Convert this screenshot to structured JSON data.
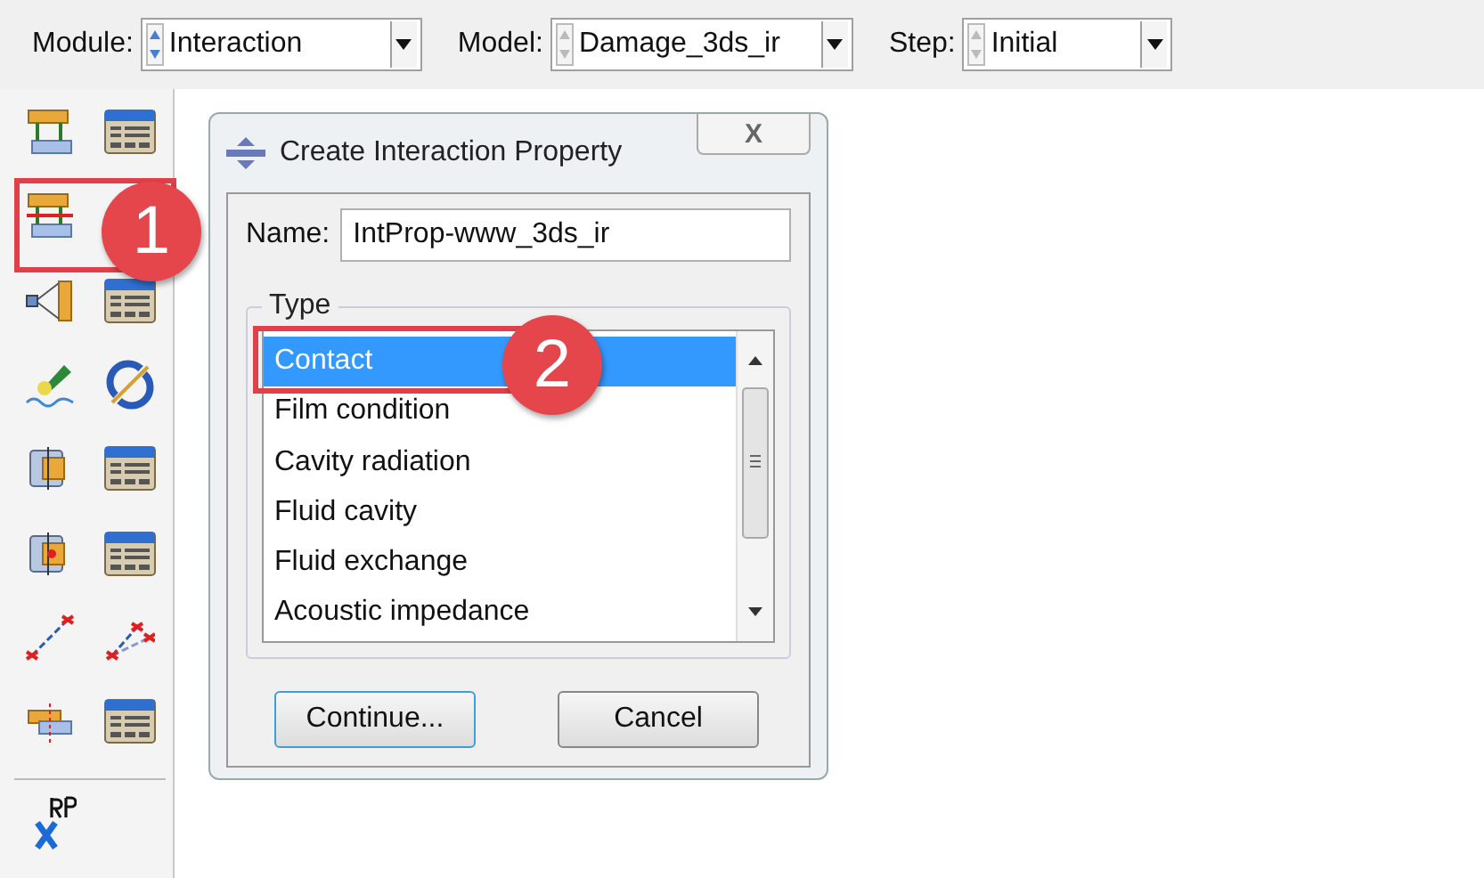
{
  "context_bar": [
    {
      "label": "Module:",
      "value": "Interaction",
      "spinner_enabled": true
    },
    {
      "label": "Model:",
      "value": "Damage_3ds_ir",
      "spinner_enabled": false
    },
    {
      "label": "Step:",
      "value": "Initial",
      "spinner_enabled": false
    }
  ],
  "dialog": {
    "title": "Create Interaction Property",
    "close_label": "X",
    "name_label": "Name:",
    "name_value": "IntProp-www_3ds_ir",
    "type_label": "Type",
    "types": [
      {
        "label": "Contact",
        "selected": true
      },
      {
        "label": "Film condition",
        "selected": false
      },
      {
        "label": "Cavity radiation",
        "selected": false
      },
      {
        "label": "Fluid cavity",
        "selected": false
      },
      {
        "label": "Fluid exchange",
        "selected": false
      },
      {
        "label": "Acoustic impedance",
        "selected": false
      }
    ],
    "buttons": [
      {
        "label": "Continue...",
        "default": true
      },
      {
        "label": "Cancel",
        "default": false
      }
    ]
  },
  "callouts": [
    {
      "number": "1"
    },
    {
      "number": "2"
    }
  ]
}
